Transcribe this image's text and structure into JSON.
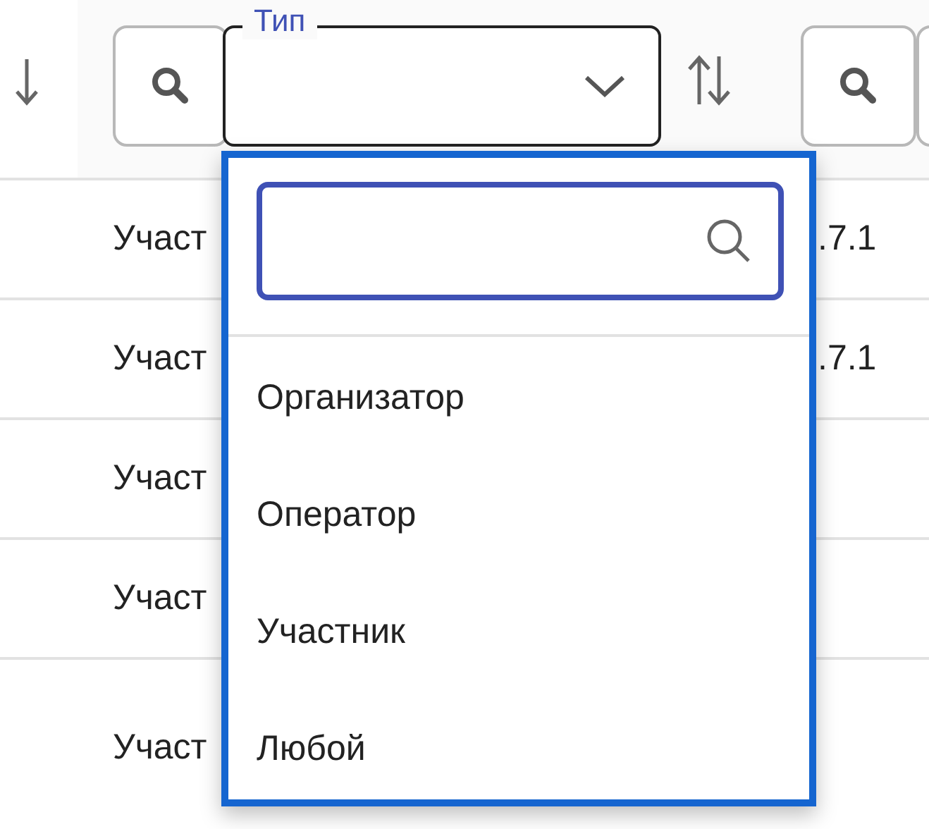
{
  "filter": {
    "label": "Тип"
  },
  "rows": [
    {
      "column_1": "Участ",
      "column_2": ".7.1"
    },
    {
      "column_1": "Участ",
      "column_2": ".7.1"
    },
    {
      "column_1": "Участ"
    },
    {
      "column_1": "Участ"
    },
    {
      "column_1": "Участ"
    }
  ],
  "dropdown": {
    "options": [
      {
        "label": "Организатор"
      },
      {
        "label": "Оператор"
      },
      {
        "label": "Участник"
      },
      {
        "label": "Любой"
      }
    ]
  }
}
